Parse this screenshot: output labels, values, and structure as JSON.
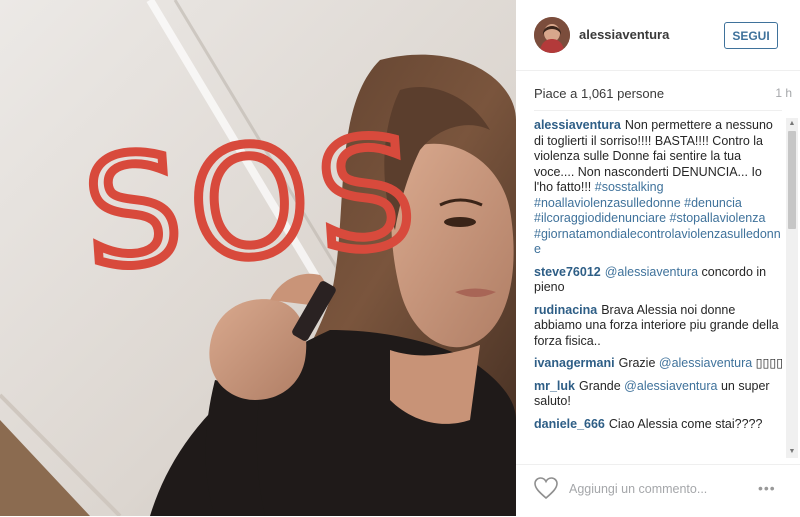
{
  "photo": {
    "scrawl_text": "SOS",
    "scrawl_color": "#d84a3c"
  },
  "header": {
    "username": "alessiaventura",
    "follow_label": "SEGUI",
    "accent_color": "#3f729b"
  },
  "likes": {
    "text": "Piace a 1,061 persone",
    "time": "1 h"
  },
  "comments": [
    {
      "user": "alessiaventura",
      "parts": [
        {
          "type": "text",
          "value": "Non permettere a nessuno di toglierti il sorriso!!!! BASTA!!!! Contro la violenza sulle Donne fai sentire la tua voce.... Non nasconderti DENUNCIA... Io l'ho fatto!!! "
        },
        {
          "type": "hashtag",
          "value": "#sosstalking"
        },
        {
          "type": "text",
          "value": " "
        },
        {
          "type": "hashtag",
          "value": "#noallaviolenzasulledonne"
        },
        {
          "type": "text",
          "value": " "
        },
        {
          "type": "hashtag",
          "value": "#denuncia"
        },
        {
          "type": "text",
          "value": " "
        },
        {
          "type": "hashtag",
          "value": "#ilcoraggiodidenunciare"
        },
        {
          "type": "text",
          "value": " "
        },
        {
          "type": "hashtag",
          "value": "#stopallaviolenza"
        },
        {
          "type": "text",
          "value": " "
        },
        {
          "type": "hashtag",
          "value": "#giornatamondialecontrolaviolenzasulledonne"
        }
      ]
    },
    {
      "user": "steve76012",
      "parts": [
        {
          "type": "mention",
          "value": "@alessiaventura"
        },
        {
          "type": "text",
          "value": " concordo in pieno"
        }
      ]
    },
    {
      "user": "rudinacina",
      "parts": [
        {
          "type": "text",
          "value": "Brava Alessia noi donne abbiamo una forza interiore piu grande della forza fisica.."
        }
      ]
    },
    {
      "user": "ivanagermani",
      "parts": [
        {
          "type": "text",
          "value": "Grazie "
        },
        {
          "type": "mention",
          "value": "@alessiaventura"
        },
        {
          "type": "text",
          "value": " ▯▯▯▯"
        }
      ]
    },
    {
      "user": "mr_luk",
      "parts": [
        {
          "type": "text",
          "value": "Grande "
        },
        {
          "type": "mention",
          "value": "@alessiaventura"
        },
        {
          "type": "text",
          "value": " un super saluto!"
        }
      ]
    },
    {
      "user": "daniele_666",
      "parts": [
        {
          "type": "text",
          "value": "Ciao Alessia come stai????"
        }
      ]
    }
  ],
  "footer": {
    "comment_placeholder": "Aggiungi un commento...",
    "more_label": "•••"
  }
}
